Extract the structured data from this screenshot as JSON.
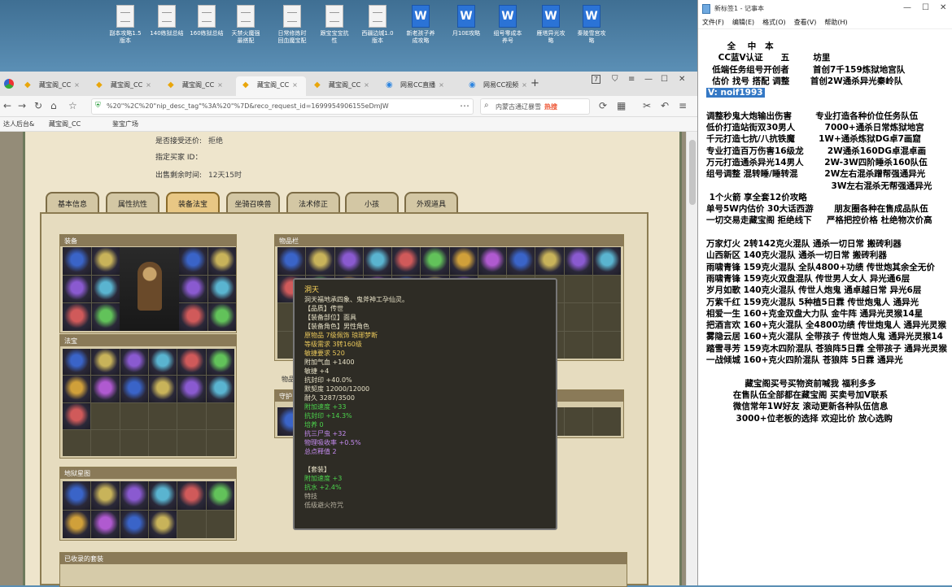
{
  "desktop": {
    "icons": [
      {
        "label": "副本攻略1.5\n版本",
        "type": "doc"
      },
      {
        "label": "140练狱总结",
        "type": "doc"
      },
      {
        "label": "160练狱总结",
        "type": "doc"
      },
      {
        "label": "天禁火魔强\n最搭配",
        "type": "doc"
      },
      {
        "label": "日常修炼时\n回血魔宝配",
        "type": "doc"
      },
      {
        "label": "跟宝宝宝抗\n性",
        "type": "doc"
      },
      {
        "label": "西疆边城1.0\n版本",
        "type": "doc"
      },
      {
        "label": "新老孩子养\n成攻略",
        "type": "word"
      },
      {
        "label": "月10E攻略",
        "type": "word"
      },
      {
        "label": "组号零成本\n养号",
        "type": "word"
      },
      {
        "label": "雁塔异光攻\n略",
        "type": "word"
      },
      {
        "label": "秦陵雪宫攻\n略",
        "type": "word"
      }
    ]
  },
  "browser": {
    "tabs": [
      {
        "label": "藏宝阁_CC",
        "active": false
      },
      {
        "label": "藏宝阁_CC",
        "active": false
      },
      {
        "label": "藏宝阁_CC",
        "active": false
      },
      {
        "label": "藏宝阁_CC",
        "active": true
      },
      {
        "label": "藏宝阁_CC",
        "active": false
      },
      {
        "label": "网易CC直播",
        "active": false
      },
      {
        "label": "网易CC视频",
        "active": false
      }
    ],
    "tab_count_badge": "7",
    "url": "%20\"%2C%20\"nip_desc_tag\"%3A%20\"%7D&reco_request_id=1699954906155eDmJW",
    "search_placeholder": "内蒙古通辽暴雪",
    "search_hot": "热搜",
    "bookmarks": [
      "达人后台&",
      "藏宝阁_CC",
      "鉴宝广场"
    ]
  },
  "page": {
    "info": [
      {
        "label": "是否接受还价:",
        "value": "拒绝"
      },
      {
        "label": "指定买家 ID：",
        "value": ""
      },
      {
        "label": "出售剩余时间:",
        "value": "12天15时"
      }
    ],
    "game_tabs": [
      "基本信息",
      "属性抗性",
      "装备法宝",
      "坐骑召唤兽",
      "法术修正",
      "小孩",
      "外观道具"
    ],
    "active_tab_index": 2,
    "sections": {
      "equip": "装备",
      "fabao": "法宝",
      "fabao_extra": "地狱星图",
      "bag": "物品栏",
      "bag2": "物品",
      "warehouse": "守护",
      "collected": "已收录的套装"
    }
  },
  "tooltip": {
    "title": "洞天",
    "desc": "洞天福地承四象、鬼斧神工孕仙灵。",
    "lines": [
      {
        "text": "【品质】传世",
        "cls": "white"
      },
      {
        "text": "【装备部位】面具",
        "cls": "white"
      },
      {
        "text": "【装备角色】男性角色",
        "cls": "white"
      },
      {
        "text": "原物品 7级佩饰 琅琊梦断",
        "cls": "gold"
      },
      {
        "text": "等级需求 3转160级",
        "cls": "gold"
      },
      {
        "text": "敏捷要求 520",
        "cls": "gold"
      },
      {
        "text": "附加气血 +1400",
        "cls": "white"
      },
      {
        "text": "敏捷 +4",
        "cls": "white"
      },
      {
        "text": "抗封印 +40.0%",
        "cls": "white"
      },
      {
        "text": "默契度 12000/12000",
        "cls": "white"
      },
      {
        "text": "耐久 3287/3500",
        "cls": "white"
      },
      {
        "text": "附加速度 +33",
        "cls": "green"
      },
      {
        "text": "抗封印 +14.3%",
        "cls": "green"
      },
      {
        "text": "培养 0",
        "cls": "green"
      },
      {
        "text": "抗三尸虫 +32",
        "cls": "purple"
      },
      {
        "text": "物理吸收率 +0.5%",
        "cls": "purple"
      },
      {
        "text": "总点释值 2",
        "cls": "purple"
      },
      {
        "text": "",
        "cls": "spacer"
      },
      {
        "text": "【套装】",
        "cls": "white"
      },
      {
        "text": "附加速度 +3",
        "cls": "green"
      },
      {
        "text": "抗水 +2.4%",
        "cls": "green"
      },
      {
        "text": "特技",
        "cls": "gray"
      },
      {
        "text": "低级避火符咒",
        "cls": "gray"
      }
    ]
  },
  "notepad": {
    "title": "新标签1 - 记事本",
    "menu": [
      "文件(F)",
      "编辑(E)",
      "格式(O)",
      "查看(V)",
      "帮助(H)"
    ],
    "body_top": "       全    中   本\n    CC蓝V认证      五        坊里    \n  低端任务组号开创者        首创7千159炼狱地宫队\n  估价 找号 搭配 调整       首创2W通杀异光秦岭队\n",
    "highlight": "V: noif1993",
    "body_rest": "\n\n调整秒鬼大炮输出伤害        专业打造各种价位任务队伍\n低价打造站街双30男人          7000+通杀日常炼狱地宫\n千元打造七抗/八抗铁魔        1W+通杀炼狱DG卓7画窟\n专业打造百万伤害16级龙        2W通杀160DG卓混卓画\n万元打造通杀异光14男人       2W-3W四阶睡杀160队伍\n组号调整 混转睡/睡转混         2W左右混杀蹭帮强通异光\n                                          3W左右混杀无帮强通异光\n 1个火箭 享全套12价攻略\n单号5W内估价 30大话西游       朋友圈各种在售成品队伍\n一切交易走藏宝阁 拒绝线下     严格把控价格 杜绝物次价高\n\n万家灯火 2转142克火混队 通杀一切日常 搬砖利器\n山西新区 140克火混队 通杀一切日常 搬砖利器\n雨啸青锋 159克火混队 全队4800+功绩 传世炮其余全无价\n雨啸青锋 159克火双盘混队 传世男人女人 异光通6层\n岁月如歌 140克火混队 传世人炮鬼 通卓越日常 异光6层\n万紫千红 159克火混队 5种植5日霖 传世炮鬼人 通异光\n相爱一生 160+克金双盘大力队 金牛阵 通异光灵猴14星\n把酒言欢 160+克火混队 全4800功绩 传世炮鬼人 通异光灵猴\n雾隐云居 160+克火混队 全带孩子 传世炮人鬼 通异光灵猴14\n踏雪寻芳 159克木四阶混队 苍狼阵5日霖 全带孩子 通异光灵猴\n一战倾城 160+克火四阶混队 苍狼阵 5日霖 通异光\n\n             藏宝阁买号买物资前喊我 福利多多\n         在售队伍全部都在藏宝阁 买卖号加V联系\n         微信常年1W好友 滚动更新各种队伍信息\n          3000+位老板的选择 欢迎比价 放心选购"
  },
  "colors": {
    "panel_bg": "#eee5cc",
    "tab_active": "#e8c784",
    "tooltip_bg": "#2e2c25",
    "highlight": "#3478c5"
  }
}
